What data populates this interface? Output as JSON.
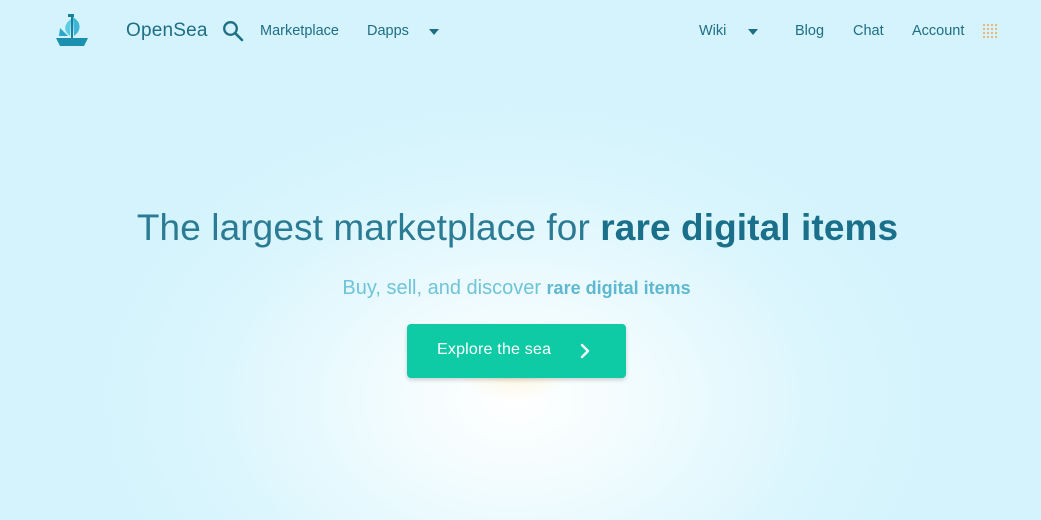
{
  "header": {
    "brand": "OpenSea",
    "nav_left": [
      {
        "label": "Marketplace"
      },
      {
        "label": "Dapps",
        "has_dropdown": true
      }
    ],
    "nav_right": [
      {
        "label": "Wiki",
        "has_dropdown": true
      },
      {
        "label": "Blog"
      },
      {
        "label": "Chat"
      },
      {
        "label": "Account"
      }
    ],
    "icons": {
      "logo": "ship-logo-icon",
      "search": "search-icon",
      "apps": "grid-dots-icon"
    }
  },
  "hero": {
    "title_prefix": "The largest marketplace for ",
    "title_strong": "rare digital items",
    "subtitle_prefix": "Buy, sell, and discover ",
    "subtitle_strong": "rare digital items",
    "cta_label": "Explore the sea",
    "cta_icon": "chevron-right-icon"
  },
  "colors": {
    "accent": "#0ecba5",
    "text_primary": "#1e6e86",
    "subtitle": "#6ec4d9",
    "background": "#d4f3fc",
    "apps_icon": "#f5a34d"
  }
}
